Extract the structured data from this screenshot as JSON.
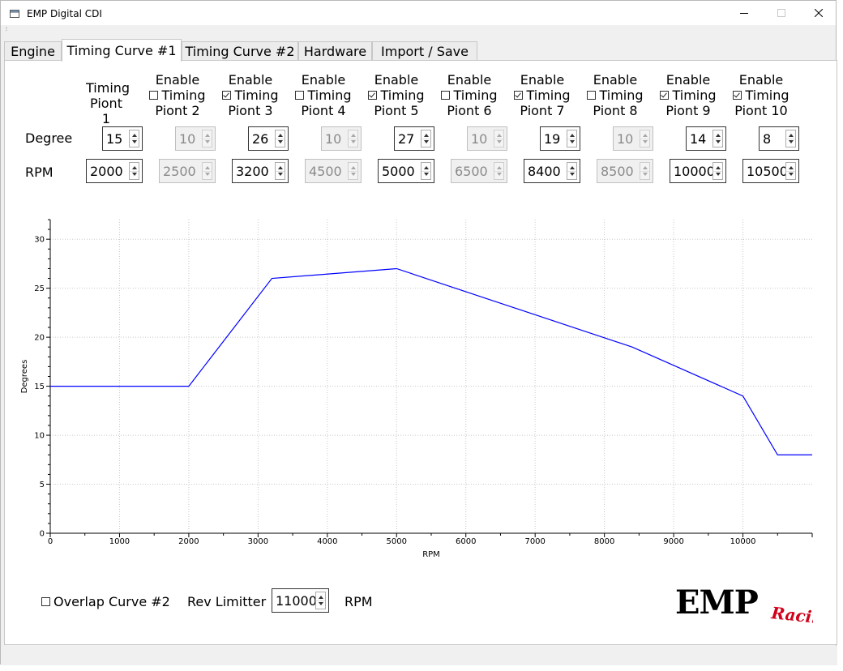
{
  "window": {
    "title": "EMP Digital CDI",
    "accent": "#0000ff"
  },
  "tabs": [
    "Engine",
    "Timing Curve #1",
    "Timing Curve #2",
    "Hardware",
    "Import / Save"
  ],
  "active_tab": 1,
  "row_labels": {
    "degree": "Degree",
    "rpm": "RPM"
  },
  "points": [
    {
      "head1": "Timing",
      "head2": "Piont 1",
      "enable_label": "",
      "checkbox": null,
      "degree": "15",
      "rpm": "2000",
      "enabled": true
    },
    {
      "head1": "Timing",
      "head2": "Piont 2",
      "enable_label": "Enable",
      "checkbox": false,
      "degree": "10",
      "rpm": "2500",
      "enabled": false
    },
    {
      "head1": "Timing",
      "head2": "Piont 3",
      "enable_label": "Enable",
      "checkbox": true,
      "degree": "26",
      "rpm": "3200",
      "enabled": true
    },
    {
      "head1": "Timing",
      "head2": "Piont 4",
      "enable_label": "Enable",
      "checkbox": false,
      "degree": "10",
      "rpm": "4500",
      "enabled": false
    },
    {
      "head1": "Timing",
      "head2": "Piont 5",
      "enable_label": "Enable",
      "checkbox": true,
      "degree": "27",
      "rpm": "5000",
      "enabled": true
    },
    {
      "head1": "Timing",
      "head2": "Piont 6",
      "enable_label": "Enable",
      "checkbox": false,
      "degree": "10",
      "rpm": "6500",
      "enabled": false
    },
    {
      "head1": "Timing",
      "head2": "Piont 7",
      "enable_label": "Enable",
      "checkbox": true,
      "degree": "19",
      "rpm": "8400",
      "enabled": true
    },
    {
      "head1": "Timing",
      "head2": "Piont 8",
      "enable_label": "Enable",
      "checkbox": false,
      "degree": "10",
      "rpm": "8500",
      "enabled": false
    },
    {
      "head1": "Timing",
      "head2": "Piont 9",
      "enable_label": "Enable",
      "checkbox": true,
      "degree": "14",
      "rpm": "10000",
      "enabled": true
    },
    {
      "head1": "Timing",
      "head2": "Piont 10",
      "enable_label": "Enable",
      "checkbox": true,
      "degree": "8",
      "rpm": "10500",
      "enabled": true
    }
  ],
  "chart_data": {
    "type": "line",
    "xlabel": "RPM",
    "ylabel": "Degrees",
    "xlim": [
      0,
      11000
    ],
    "ylim": [
      0,
      32
    ],
    "xticks": [
      0,
      1000,
      2000,
      3000,
      4000,
      5000,
      6000,
      7000,
      8000,
      9000,
      10000
    ],
    "yticks": [
      0,
      5,
      10,
      15,
      20,
      25,
      30
    ],
    "grid": true,
    "series": [
      {
        "x": [
          0,
          2000,
          3200,
          5000,
          8400,
          10000,
          10500,
          11000
        ],
        "y": [
          15,
          15,
          26,
          27,
          19,
          14,
          8,
          8
        ],
        "color": "#0000ff"
      }
    ]
  },
  "bottom": {
    "overlap_label": "Overlap Curve #2",
    "overlap_checked": false,
    "rev_label": "Rev Limitter",
    "rev_value": "11000",
    "rev_unit": "RPM"
  },
  "logo": {
    "main": "EMP",
    "script": "Racing",
    "script_color": "#d0021b"
  }
}
